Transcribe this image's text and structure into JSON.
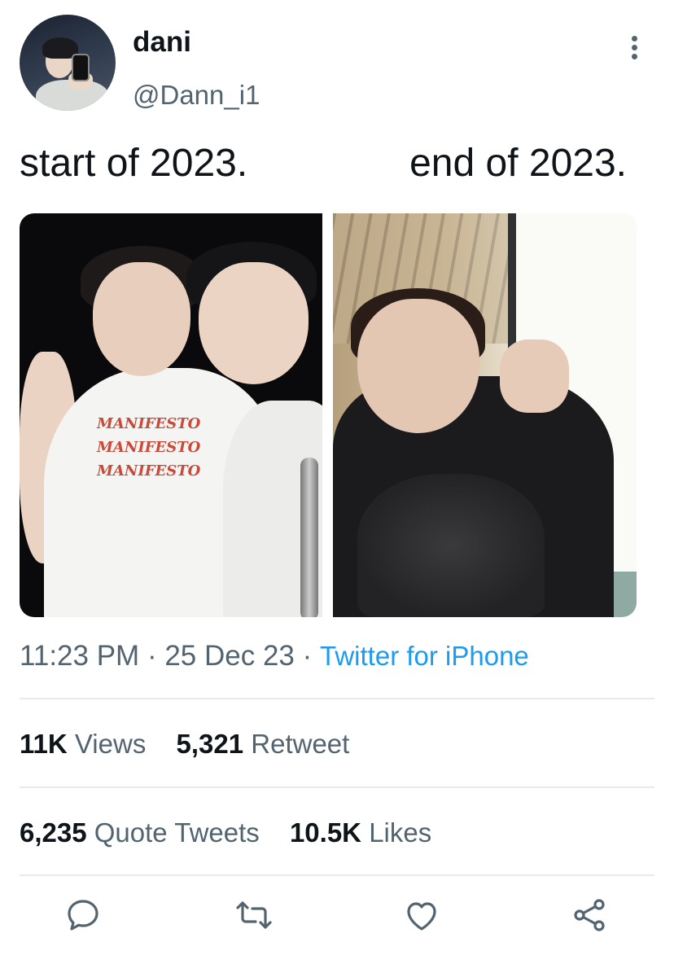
{
  "author": {
    "display_name": "dani",
    "handle": "@Dann_i1"
  },
  "tweet": {
    "text_left": "start of 2023.",
    "text_right": "end of 2023.",
    "time": "11:23 PM",
    "separator1": " · ",
    "date": "25 Dec 23",
    "separator2": " · ",
    "source": "Twitter for iPhone",
    "shirt_print": [
      "MANIFESTO",
      "MANIFESTO",
      "MANIFESTO"
    ]
  },
  "stats": {
    "views_count": "11K",
    "views_label": "Views",
    "retweets_count": "5,321",
    "retweets_label": "Retweet",
    "quotes_count": "6,235",
    "quotes_label": "Quote Tweets",
    "likes_count": "10.5K",
    "likes_label": "Likes"
  },
  "icons": {
    "more": "more-vertical-icon",
    "reply": "reply-icon",
    "retweet": "retweet-icon",
    "like": "heart-icon",
    "share": "share-icon"
  },
  "colors": {
    "text": "#0f1419",
    "secondary": "#536471",
    "link": "#1d9bf0",
    "divider": "#e6eaed"
  }
}
